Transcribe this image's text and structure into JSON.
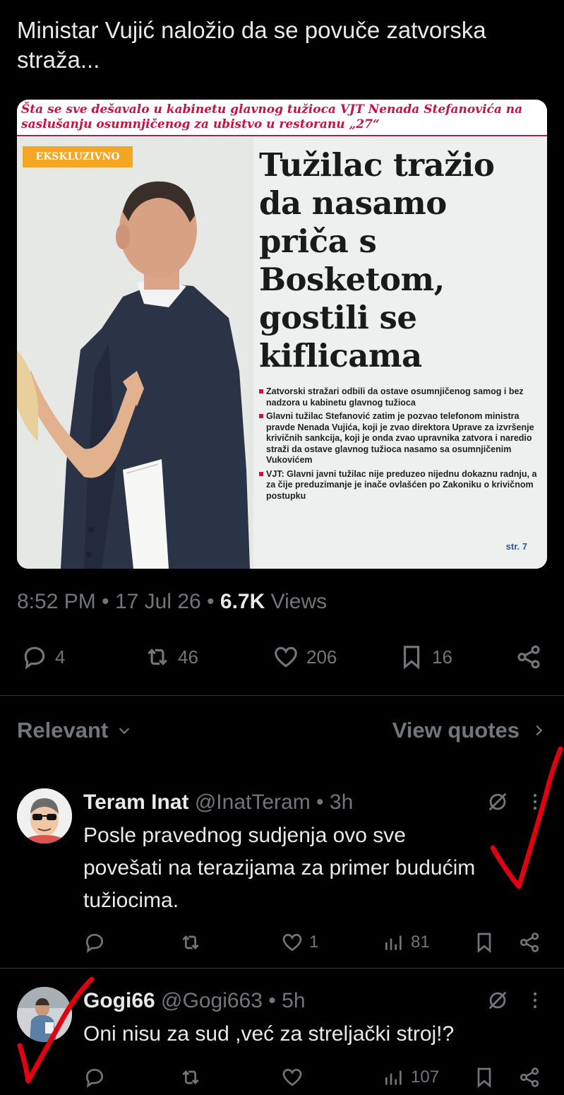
{
  "tweet": {
    "text": "Ministar Vujić naložio da se povuče zatvorska straža...",
    "clipping": {
      "kicker": "Šta se sve dešavalo u kabinetu glavnog tužioca VJT Nenada Stefanovića na saslušanju osumnjičenog za ubistvo u restoranu „27“",
      "badge": "EKSKLUZIVNO",
      "headline": "Tužilac tražio da nasamo priča s Bosketom, gostili se kiflicama",
      "bullets": [
        "Zatvorski stražari odbili da ostave osumnjičenog samog i bez nadzora u kabinetu glavnog tužioca",
        "Glavni tužilac Stefanović zatim je pozvao telefonom ministra pravde Nenada Vujića, koji je zvao direktora Uprave za izvršenje krivičnih sankcija, koji je onda zvao upravnika zatvora i naredio straži da ostave glavnog tužioca nasamo sa osumnjičenim Vukovićem",
        "VJT: Glavni javni tužilac nije preduzeo nijednu dokaznu radnju, a za čije preduzimanje je inače ovlašćen po Zakoniku o krivičnom postupku"
      ],
      "page_ref": "str. 7"
    },
    "meta": {
      "time": "8:52 PM",
      "sep": "•",
      "date": "17 Jul 26",
      "views_count": "6.7K",
      "views_label": "Views"
    },
    "actions": {
      "replies": "4",
      "reposts": "46",
      "likes": "206",
      "bookmarks": "16"
    }
  },
  "sort": {
    "relevant_label": "Relevant",
    "view_quotes_label": "View quotes"
  },
  "replies": [
    {
      "name": "Teram Inat",
      "handle": "@InatTeram",
      "age": "3h",
      "text": "Posle pravednog sudjenja ovo sve povešati na terazijama za primer budućim tužiocima.",
      "likes": "1",
      "views": "81"
    },
    {
      "name": "Gogi66",
      "handle": "@Gogi663",
      "age": "5h",
      "text": "Oni nisu za sud ,već za streljački stroj!?",
      "likes": "",
      "views": "107"
    }
  ],
  "colors": {
    "background": "#000000",
    "text": "#e7e9ea",
    "muted": "#71767b",
    "annotation_check": "#e0000f"
  }
}
